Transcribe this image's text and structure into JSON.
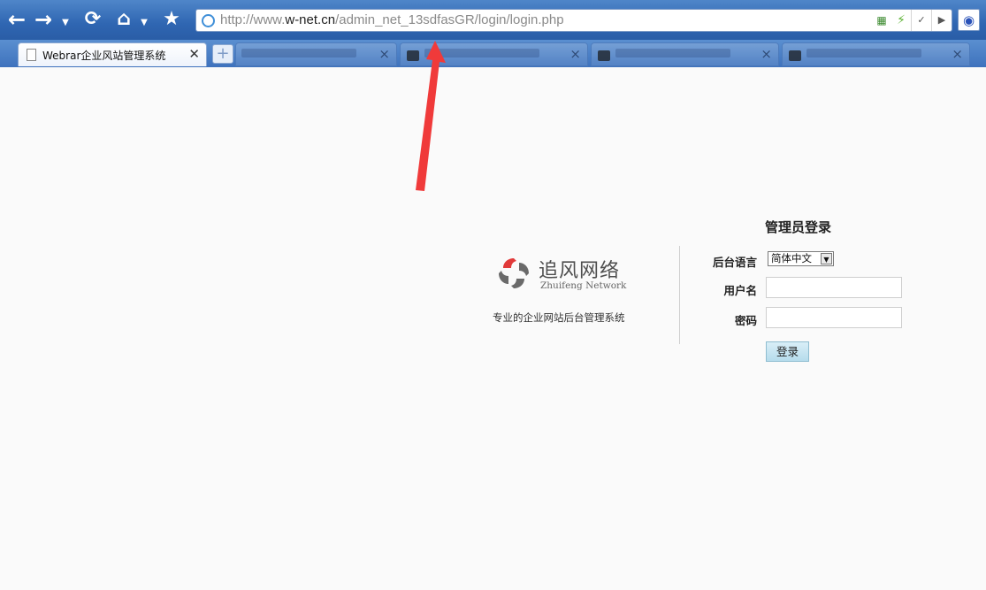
{
  "browser": {
    "address_url": "http://www.w-net.cn/admin_net_13sdfasGR/login/login.php",
    "address_url_prefix": "http://www.",
    "address_url_domain": "w-net.cn",
    "address_url_path": "/admin_net_13sdfasGR/login/login.php",
    "tabs": [
      {
        "title": "Webrar企业风站管理系统",
        "active": true
      }
    ],
    "icons": [
      "back-icon",
      "forward-icon",
      "refresh-icon",
      "home-icon",
      "favorites-star-icon",
      "qr-icon",
      "lightning-icon",
      "dropdown-icon",
      "go-icon",
      "baidu-paw-icon",
      "new-tab-plus-icon",
      "page-icon",
      "close-icon"
    ]
  },
  "logo": {
    "name_cn": "追风网络",
    "name_en": "Zhuifeng Network"
  },
  "slogan": "专业的企业网站后台管理系统",
  "login": {
    "title": "管理员登录",
    "language_label": "后台语言",
    "language_value": "简体中文",
    "username_label": "用户名",
    "username_value": "",
    "password_label": "密码",
    "password_value": "",
    "submit_label": "登录"
  },
  "colors": {
    "arrow": "#f03a3a",
    "toolbar": "#3a6fb8",
    "page_bg": "#fafafa"
  }
}
